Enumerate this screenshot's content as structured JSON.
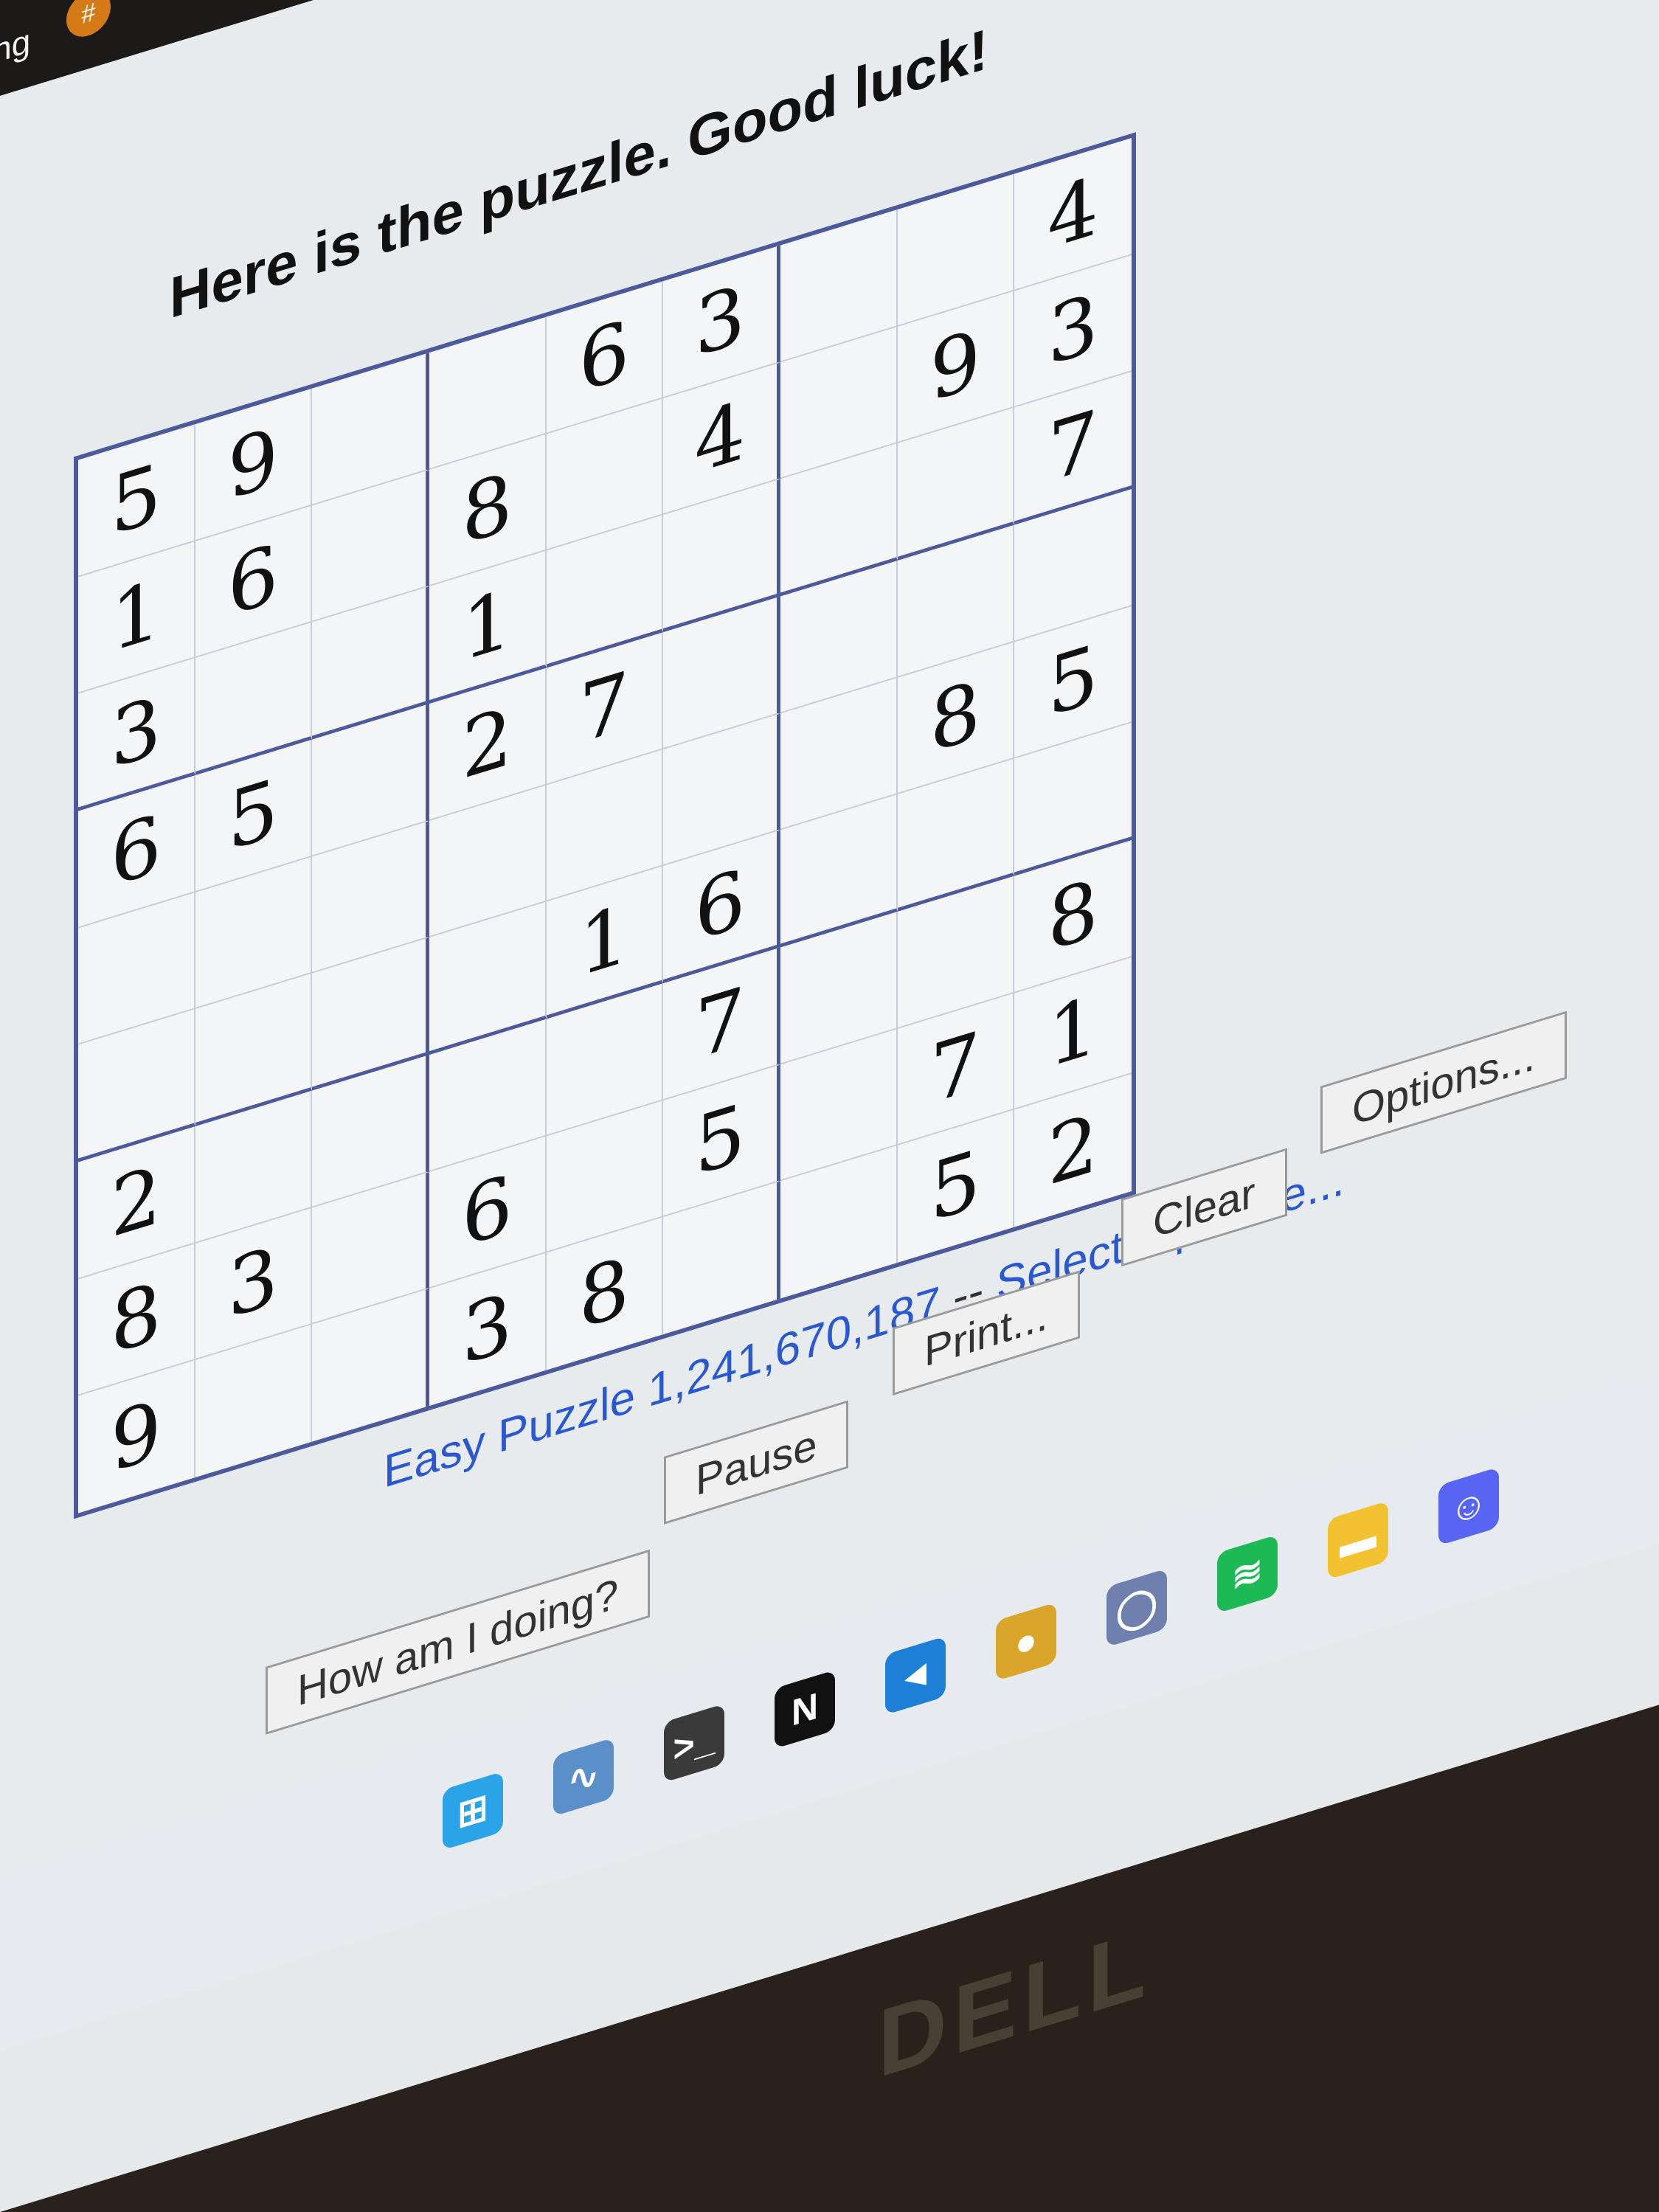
{
  "top_tab": {
    "label": "ing",
    "icon": "app-icon"
  },
  "title": "Here is the puzzle. Good luck!",
  "grid": [
    [
      "5",
      "9",
      "",
      "",
      "6",
      "3",
      "",
      "",
      "4"
    ],
    [
      "1",
      "6",
      "",
      "8",
      "",
      "4",
      "",
      "9",
      "3"
    ],
    [
      "3",
      "",
      "",
      "1",
      "",
      "",
      "",
      "",
      "7"
    ],
    [
      "6",
      "5",
      "",
      "2",
      "7",
      "",
      "",
      "",
      ""
    ],
    [
      "",
      "",
      "",
      "",
      "",
      "",
      "",
      "8",
      "5"
    ],
    [
      "",
      "",
      "",
      "",
      "1",
      "6",
      "",
      "",
      ""
    ],
    [
      "2",
      "",
      "",
      "",
      "",
      "7",
      "",
      "",
      "8"
    ],
    [
      "8",
      "3",
      "",
      "6",
      "",
      "5",
      "",
      "7",
      "1"
    ],
    [
      "9",
      "",
      "",
      "3",
      "8",
      "",
      "",
      "5",
      "2"
    ]
  ],
  "puzzle_label": "Easy Puzzle 1,241,670,187",
  "puzzle_sep": " -- ",
  "select_link": "Select a puzzle...",
  "buttons": {
    "how": "How am I doing?",
    "pause": "Pause",
    "print": "Print...",
    "clear": "Clear",
    "options": "Options..."
  },
  "taskbar": [
    {
      "name": "windows-start-icon",
      "glyph": "⊞",
      "color": "#2aa3e8"
    },
    {
      "name": "task-manager-icon",
      "glyph": "∿",
      "color": "#5b8fc9"
    },
    {
      "name": "terminal-icon",
      "glyph": ">_",
      "color": "#3a3a3a"
    },
    {
      "name": "netflix-icon",
      "glyph": "N",
      "color": "#111111"
    },
    {
      "name": "vscode-icon",
      "glyph": "◄",
      "color": "#1e7fd6"
    },
    {
      "name": "chrome-icon",
      "glyph": "●",
      "color": "#d9a52b"
    },
    {
      "name": "geogebra-icon",
      "glyph": "◯",
      "color": "#6f7fae"
    },
    {
      "name": "spotify-icon",
      "glyph": "≋",
      "color": "#1db954"
    },
    {
      "name": "file-explorer-icon",
      "glyph": "▬",
      "color": "#f2c230"
    },
    {
      "name": "discord-icon",
      "glyph": "☺",
      "color": "#5865f2"
    }
  ],
  "bezel_logo": "DELL"
}
